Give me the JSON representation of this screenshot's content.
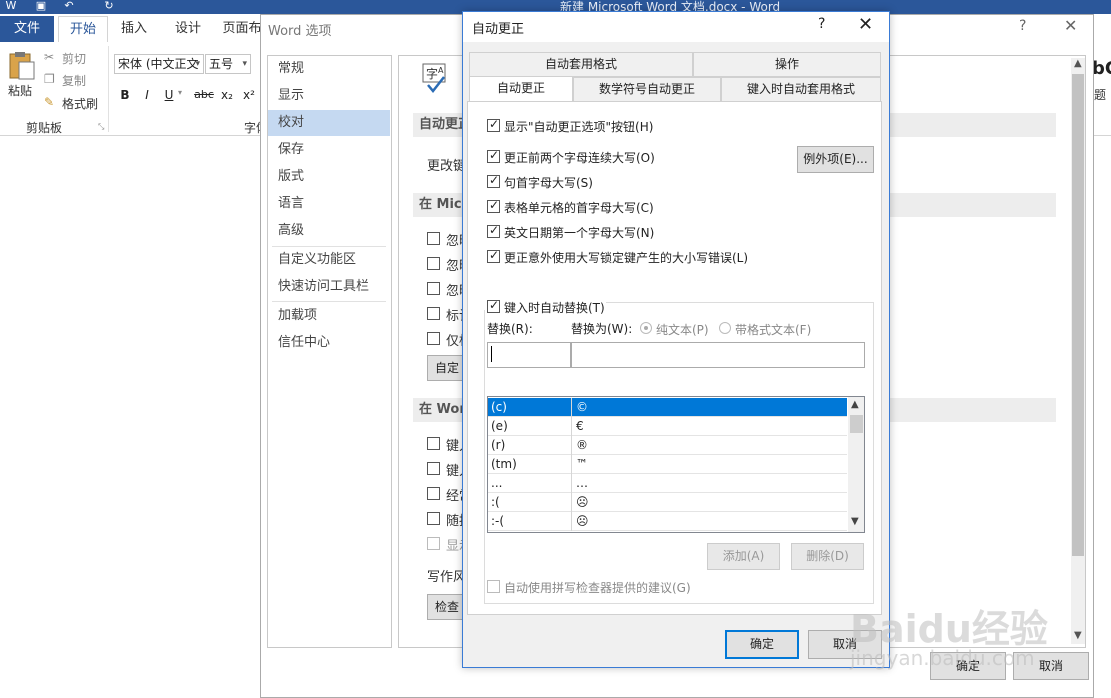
{
  "word": {
    "doc_title": "新建 Microsoft Word 文档.docx - Word",
    "tabs": [
      "文件",
      "开始",
      "插入",
      "设计",
      "页面布"
    ],
    "clipboard": {
      "paste": "粘贴",
      "cut": "剪切",
      "copy": "复制",
      "format_painter": "格式刷",
      "group_label": "剪贴板"
    },
    "font": {
      "name": "宋体 (中文正文",
      "size": "五号",
      "group_label": "字体",
      "bold": "B",
      "italic": "I",
      "underline": "U",
      "strike": "abc",
      "sub": "x₂",
      "sup": "x²"
    },
    "right_frag1": "bC",
    "right_frag2": "题"
  },
  "word_options": {
    "title": "Word 选项",
    "help": "?",
    "close": "✕",
    "nav": [
      "常规",
      "显示",
      "校对",
      "保存",
      "版式",
      "语言",
      "高级",
      "自定义功能区",
      "快速访问工具栏",
      "加载项",
      "信任中心"
    ],
    "nav_selected": 2,
    "section1": "自动更正",
    "change_label": "更改键",
    "section2": "在 Micr",
    "checks_a": [
      "忽略",
      "忽略",
      "忽略",
      "标记",
      "仅标"
    ],
    "custom_btn": "自定",
    "section3": "在 Word",
    "checks_b": [
      "键入",
      "键入",
      "经常",
      "随拍",
      "显示"
    ],
    "writing_style": "写作风",
    "check_btn": "检查",
    "ok": "确定",
    "cancel": "取消"
  },
  "autocorrect": {
    "title": "自动更正",
    "help": "?",
    "close": "✕",
    "tabs_top": [
      "自动套用格式",
      "操作"
    ],
    "tabs_bottom": [
      "自动更正",
      "数学符号自动更正",
      "键入时自动套用格式"
    ],
    "options": [
      {
        "label": "显示\"自动更正选项\"按钮(H)",
        "checked": true
      },
      {
        "label": "更正前两个字母连续大写(O)",
        "checked": true
      },
      {
        "label": "句首字母大写(S)",
        "checked": true
      },
      {
        "label": "表格单元格的首字母大写(C)",
        "checked": true
      },
      {
        "label": "英文日期第一个字母大写(N)",
        "checked": true
      },
      {
        "label": "更正意外使用大写锁定键产生的大小写错误(L)",
        "checked": true
      }
    ],
    "exceptions_btn": "例外项(E)...",
    "replace_as_you_type": {
      "label": "键入时自动替换(T)",
      "checked": true
    },
    "replace_label": "替换(R):",
    "with_label": "替换为(W):",
    "radio_plain": "纯文本(P)",
    "radio_formatted": "带格式文本(F)",
    "replace_value": "",
    "with_value": "",
    "entries": [
      [
        "(c)",
        "©"
      ],
      [
        "(e)",
        "€"
      ],
      [
        "(r)",
        "®"
      ],
      [
        "(tm)",
        "™"
      ],
      [
        "...",
        "…"
      ],
      [
        ":(",
        "☹"
      ],
      [
        ":-(",
        "☹"
      ]
    ],
    "selected_row": 0,
    "add_btn": "添加(A)",
    "delete_btn": "删除(D)",
    "spell_suggest": {
      "label": "自动使用拼写检查器提供的建议(G)",
      "checked": false
    },
    "ok": "确定",
    "cancel": "取消"
  },
  "watermark": {
    "text": "Baidu经验",
    "url": "jingyan.baidu.com"
  }
}
